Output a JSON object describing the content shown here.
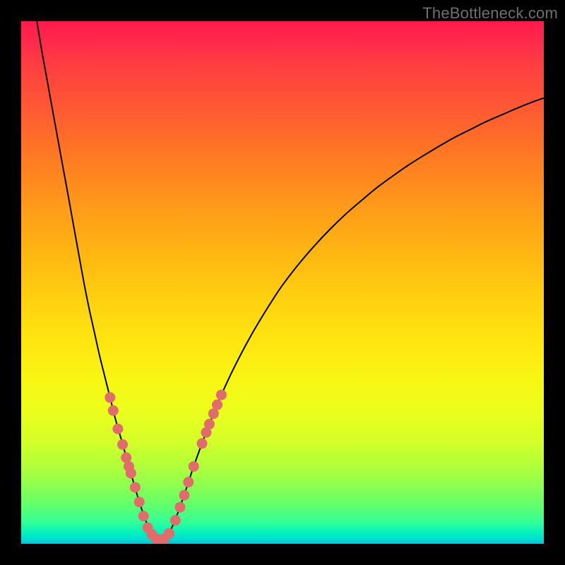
{
  "watermark": "TheBottleneck.com",
  "colors": {
    "curve_stroke": "#000000",
    "marker_fill": "#e06c6c",
    "marker_stroke": "#c24f4f"
  },
  "chart_data": {
    "type": "line",
    "title": "",
    "xlabel": "",
    "ylabel": "",
    "xlim": [
      0,
      100
    ],
    "ylim": [
      0,
      100
    ],
    "notes": "Bottleneck-style V-curve. y-axis is inverted visually (0 = bottom/green = optimal, 100 = top/red = worst). Minimum at x ≈ 26.",
    "curve": [
      {
        "x": 3.0,
        "y": 100.0
      },
      {
        "x": 4.0,
        "y": 94.0
      },
      {
        "x": 5.0,
        "y": 88.5
      },
      {
        "x": 6.0,
        "y": 83.0
      },
      {
        "x": 7.0,
        "y": 77.5
      },
      {
        "x": 8.0,
        "y": 72.0
      },
      {
        "x": 9.0,
        "y": 66.6
      },
      {
        "x": 10.0,
        "y": 61.0
      },
      {
        "x": 11.0,
        "y": 55.5
      },
      {
        "x": 12.0,
        "y": 50.0
      },
      {
        "x": 13.0,
        "y": 45.0
      },
      {
        "x": 14.0,
        "y": 40.5
      },
      {
        "x": 15.0,
        "y": 36.0
      },
      {
        "x": 16.0,
        "y": 32.0
      },
      {
        "x": 17.0,
        "y": 28.0
      },
      {
        "x": 18.0,
        "y": 24.0
      },
      {
        "x": 19.0,
        "y": 20.5
      },
      {
        "x": 20.0,
        "y": 17.0
      },
      {
        "x": 21.0,
        "y": 13.5
      },
      {
        "x": 22.0,
        "y": 10.0
      },
      {
        "x": 23.0,
        "y": 6.8
      },
      {
        "x": 24.0,
        "y": 4.0
      },
      {
        "x": 25.0,
        "y": 1.8
      },
      {
        "x": 26.0,
        "y": 0.8
      },
      {
        "x": 27.0,
        "y": 0.8
      },
      {
        "x": 28.0,
        "y": 1.5
      },
      {
        "x": 29.0,
        "y": 3.5
      },
      {
        "x": 30.0,
        "y": 6.0
      },
      {
        "x": 31.0,
        "y": 8.8
      },
      {
        "x": 32.0,
        "y": 11.8
      },
      {
        "x": 33.0,
        "y": 14.8
      },
      {
        "x": 34.0,
        "y": 17.6
      },
      {
        "x": 35.0,
        "y": 20.3
      },
      {
        "x": 36.0,
        "y": 22.9
      },
      {
        "x": 38.0,
        "y": 27.8
      },
      {
        "x": 40.0,
        "y": 32.2
      },
      {
        "x": 42.0,
        "y": 36.2
      },
      {
        "x": 44.0,
        "y": 39.9
      },
      {
        "x": 46.0,
        "y": 43.3
      },
      {
        "x": 48.0,
        "y": 46.5
      },
      {
        "x": 50.0,
        "y": 49.5
      },
      {
        "x": 53.0,
        "y": 53.4
      },
      {
        "x": 56.0,
        "y": 56.9
      },
      {
        "x": 59.0,
        "y": 60.1
      },
      {
        "x": 62.0,
        "y": 63.0
      },
      {
        "x": 65.0,
        "y": 65.6
      },
      {
        "x": 68.0,
        "y": 68.1
      },
      {
        "x": 71.0,
        "y": 70.3
      },
      {
        "x": 74.0,
        "y": 72.4
      },
      {
        "x": 77.0,
        "y": 74.3
      },
      {
        "x": 80.0,
        "y": 76.1
      },
      {
        "x": 83.0,
        "y": 77.8
      },
      {
        "x": 86.0,
        "y": 79.3
      },
      {
        "x": 89.0,
        "y": 80.8
      },
      {
        "x": 92.0,
        "y": 82.1
      },
      {
        "x": 95.0,
        "y": 83.4
      },
      {
        "x": 98.0,
        "y": 84.6
      },
      {
        "x": 100.0,
        "y": 85.3
      }
    ],
    "markers": [
      {
        "x": 17.0,
        "y": 28.0
      },
      {
        "x": 17.6,
        "y": 25.5
      },
      {
        "x": 18.5,
        "y": 22.0
      },
      {
        "x": 19.4,
        "y": 19.0
      },
      {
        "x": 20.1,
        "y": 16.5
      },
      {
        "x": 20.6,
        "y": 14.8
      },
      {
        "x": 21.0,
        "y": 13.5
      },
      {
        "x": 21.8,
        "y": 10.8
      },
      {
        "x": 22.6,
        "y": 8.0
      },
      {
        "x": 23.4,
        "y": 5.3
      },
      {
        "x": 24.2,
        "y": 3.1
      },
      {
        "x": 25.0,
        "y": 1.8
      },
      {
        "x": 25.8,
        "y": 1.0
      },
      {
        "x": 26.5,
        "y": 0.8
      },
      {
        "x": 27.4,
        "y": 1.0
      },
      {
        "x": 28.3,
        "y": 2.0
      },
      {
        "x": 29.5,
        "y": 4.5
      },
      {
        "x": 30.4,
        "y": 7.0
      },
      {
        "x": 31.2,
        "y": 9.3
      },
      {
        "x": 32.0,
        "y": 11.8
      },
      {
        "x": 33.0,
        "y": 14.8
      },
      {
        "x": 34.6,
        "y": 19.2
      },
      {
        "x": 35.4,
        "y": 21.3
      },
      {
        "x": 36.0,
        "y": 22.9
      },
      {
        "x": 36.8,
        "y": 24.9
      },
      {
        "x": 37.5,
        "y": 26.6
      },
      {
        "x": 38.3,
        "y": 28.5
      }
    ]
  }
}
